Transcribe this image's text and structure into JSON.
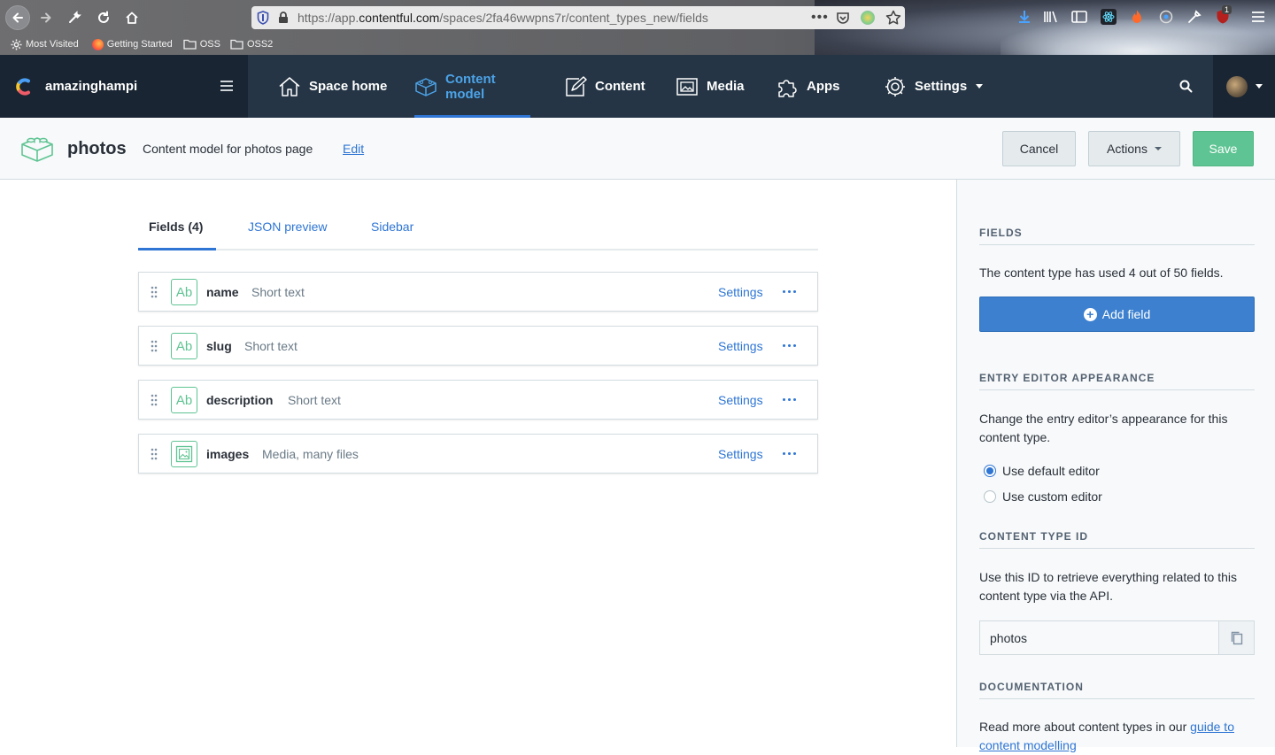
{
  "browser": {
    "url_prefix": "https://app.",
    "url_domain": "contentful.com",
    "url_path": "/spaces/2fa46wwpns7r/content_types_new/fields",
    "bookmarks": [
      {
        "label": "Most Visited",
        "icon": "gear-icon"
      },
      {
        "label": "Getting Started",
        "icon": "firefox-icon"
      },
      {
        "label": "OSS",
        "icon": "folder-icon"
      },
      {
        "label": "OSS2",
        "icon": "folder-icon"
      }
    ],
    "notification_badge": "1"
  },
  "app": {
    "space_name": "amazinghampi",
    "nav": [
      {
        "label": "Space home",
        "icon": "home-icon"
      },
      {
        "label": "Content model",
        "icon": "content-model-icon",
        "active": true
      },
      {
        "label": "Content",
        "icon": "content-icon"
      },
      {
        "label": "Media",
        "icon": "media-icon"
      },
      {
        "label": "Apps",
        "icon": "apps-icon"
      },
      {
        "label": "Settings",
        "icon": "settings-icon"
      }
    ]
  },
  "header": {
    "title": "photos",
    "description": "Content model for photos page",
    "edit_label": "Edit",
    "cancel_label": "Cancel",
    "actions_label": "Actions",
    "save_label": "Save"
  },
  "tabs": [
    {
      "label": "Fields (4)",
      "active": true
    },
    {
      "label": "JSON preview"
    },
    {
      "label": "Sidebar"
    }
  ],
  "fields": [
    {
      "name": "name",
      "type": "Short text",
      "icon": "text-field-icon",
      "icon_text": "Ab",
      "settings_label": "Settings"
    },
    {
      "name": "slug",
      "type": "Short text",
      "icon": "text-field-icon",
      "icon_text": "Ab",
      "settings_label": "Settings"
    },
    {
      "name": "description",
      "type": "Short text",
      "icon": "text-field-icon",
      "icon_text": "Ab",
      "settings_label": "Settings"
    },
    {
      "name": "images",
      "type": "Media, many files",
      "icon": "media-field-icon",
      "icon_text": "",
      "settings_label": "Settings"
    }
  ],
  "sidebar": {
    "fields_heading": "FIELDS",
    "fields_text": "The content type has used 4 out of 50 fields.",
    "add_field_label": "Add field",
    "appearance_heading": "ENTRY EDITOR APPEARANCE",
    "appearance_text": "Change the entry editor’s appearance for this content type.",
    "option_default": "Use default editor",
    "option_custom": "Use custom editor",
    "selected_option": "Use default editor",
    "ctid_heading": "CONTENT TYPE ID",
    "ctid_text": "Use this ID to retrieve everything related to this content type via the API.",
    "ctid_value": "photos",
    "docs_heading": "DOCUMENTATION",
    "docs_text_prefix": "Read more about content types in our ",
    "docs_link": "guide to content modelling"
  },
  "colors": {
    "nav_bg": "#253545",
    "accent": "#2e75d4",
    "save_green": "#5fc493"
  }
}
